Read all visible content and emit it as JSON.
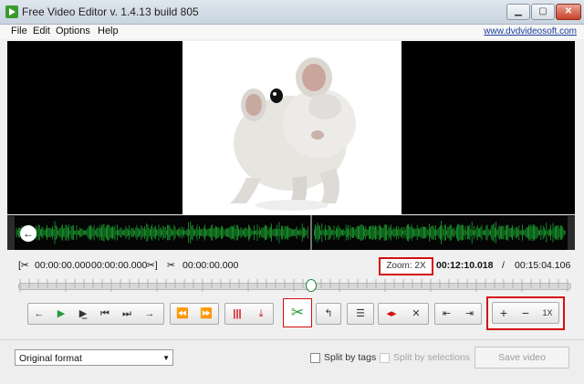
{
  "window": {
    "title": "Free Video Editor v. 1.4.13 build 805",
    "controls": [
      "minimize-icon",
      "maximize-icon",
      "close-icon"
    ]
  },
  "menu": {
    "items": [
      "File",
      "Edit",
      "Options",
      "Help"
    ],
    "site": "www.dvdvideosoft.com"
  },
  "timeline": {
    "selection_start": "00:00:00.000",
    "selection_end": "00:00:00.000",
    "marker": "00:00:00.000",
    "zoom": "Zoom: 2X",
    "current_time": "00:12:10.018",
    "separator": "/",
    "total_time": "00:15:04.106",
    "position_fraction": 0.53
  },
  "toolbar": {
    "buttons": [
      "prev-frame-icon",
      "play-icon",
      "play-selection-icon",
      "go-start-icon",
      "go-end-icon",
      "next-frame-icon",
      "prev-marker-icon",
      "next-marker-icon",
      "split-icon",
      "delete-icon",
      "cut-icon",
      "rotate-icon",
      "adjust-icon",
      "marker-in-out-icon",
      "remove-marker-icon",
      "jump-start-icon",
      "jump-end-icon",
      "zoom-in-icon",
      "zoom-out-icon",
      "zoom-reset-icon"
    ],
    "zoom_in": "+",
    "zoom_out": "−",
    "zoom_reset": "1X"
  },
  "bottom": {
    "format": "Original format",
    "split_by_tags": "Split by tags",
    "split_by_selections": "Split by selections",
    "save": "Save video"
  },
  "colors": {
    "accent_green": "#1f9d38",
    "highlight_red": "#d50f0f",
    "wave_green": "#1aa12f"
  }
}
